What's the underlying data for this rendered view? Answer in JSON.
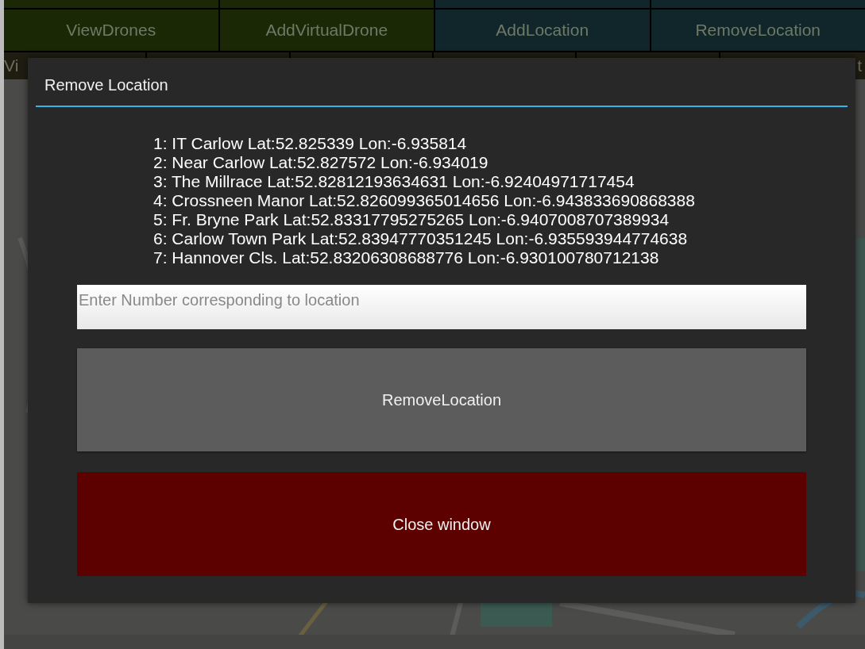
{
  "toolbar": {
    "buttons": [
      {
        "label": "ViewDrones",
        "color": "#1a2806"
      },
      {
        "label": "AddVirtualDrone",
        "color": "#1a2806"
      },
      {
        "label": "AddLocation",
        "color": "#10262b"
      },
      {
        "label": "RemoveLocation",
        "color": "#10262b"
      }
    ],
    "partial_row": [
      {
        "label": "Vi"
      },
      {
        "label": "t"
      }
    ]
  },
  "dialog": {
    "title": "Remove Location",
    "locations": [
      "1: IT Carlow Lat:52.825339 Lon:-6.935814",
      "2: Near Carlow Lat:52.827572 Lon:-6.934019",
      "3: The Millrace Lat:52.82812193634631 Lon:-6.92404971717454",
      "4: Crossneen Manor Lat:52.826099365014656 Lon:-6.943833690868388",
      "5: Fr. Bryne Park Lat:52.83317795275265 Lon:-6.9407008707389934",
      "6: Carlow Town Park Lat:52.83947770351245 Lon:-6.935593944774638",
      "7: Hannover Cls. Lat:52.83206308688776 Lon:-6.930100780712138"
    ],
    "input": {
      "placeholder": "Enter Number corresponding to location"
    },
    "buttons": [
      {
        "label": "RemoveLocation",
        "kind": "action"
      },
      {
        "label": "Close window",
        "kind": "danger"
      }
    ]
  }
}
